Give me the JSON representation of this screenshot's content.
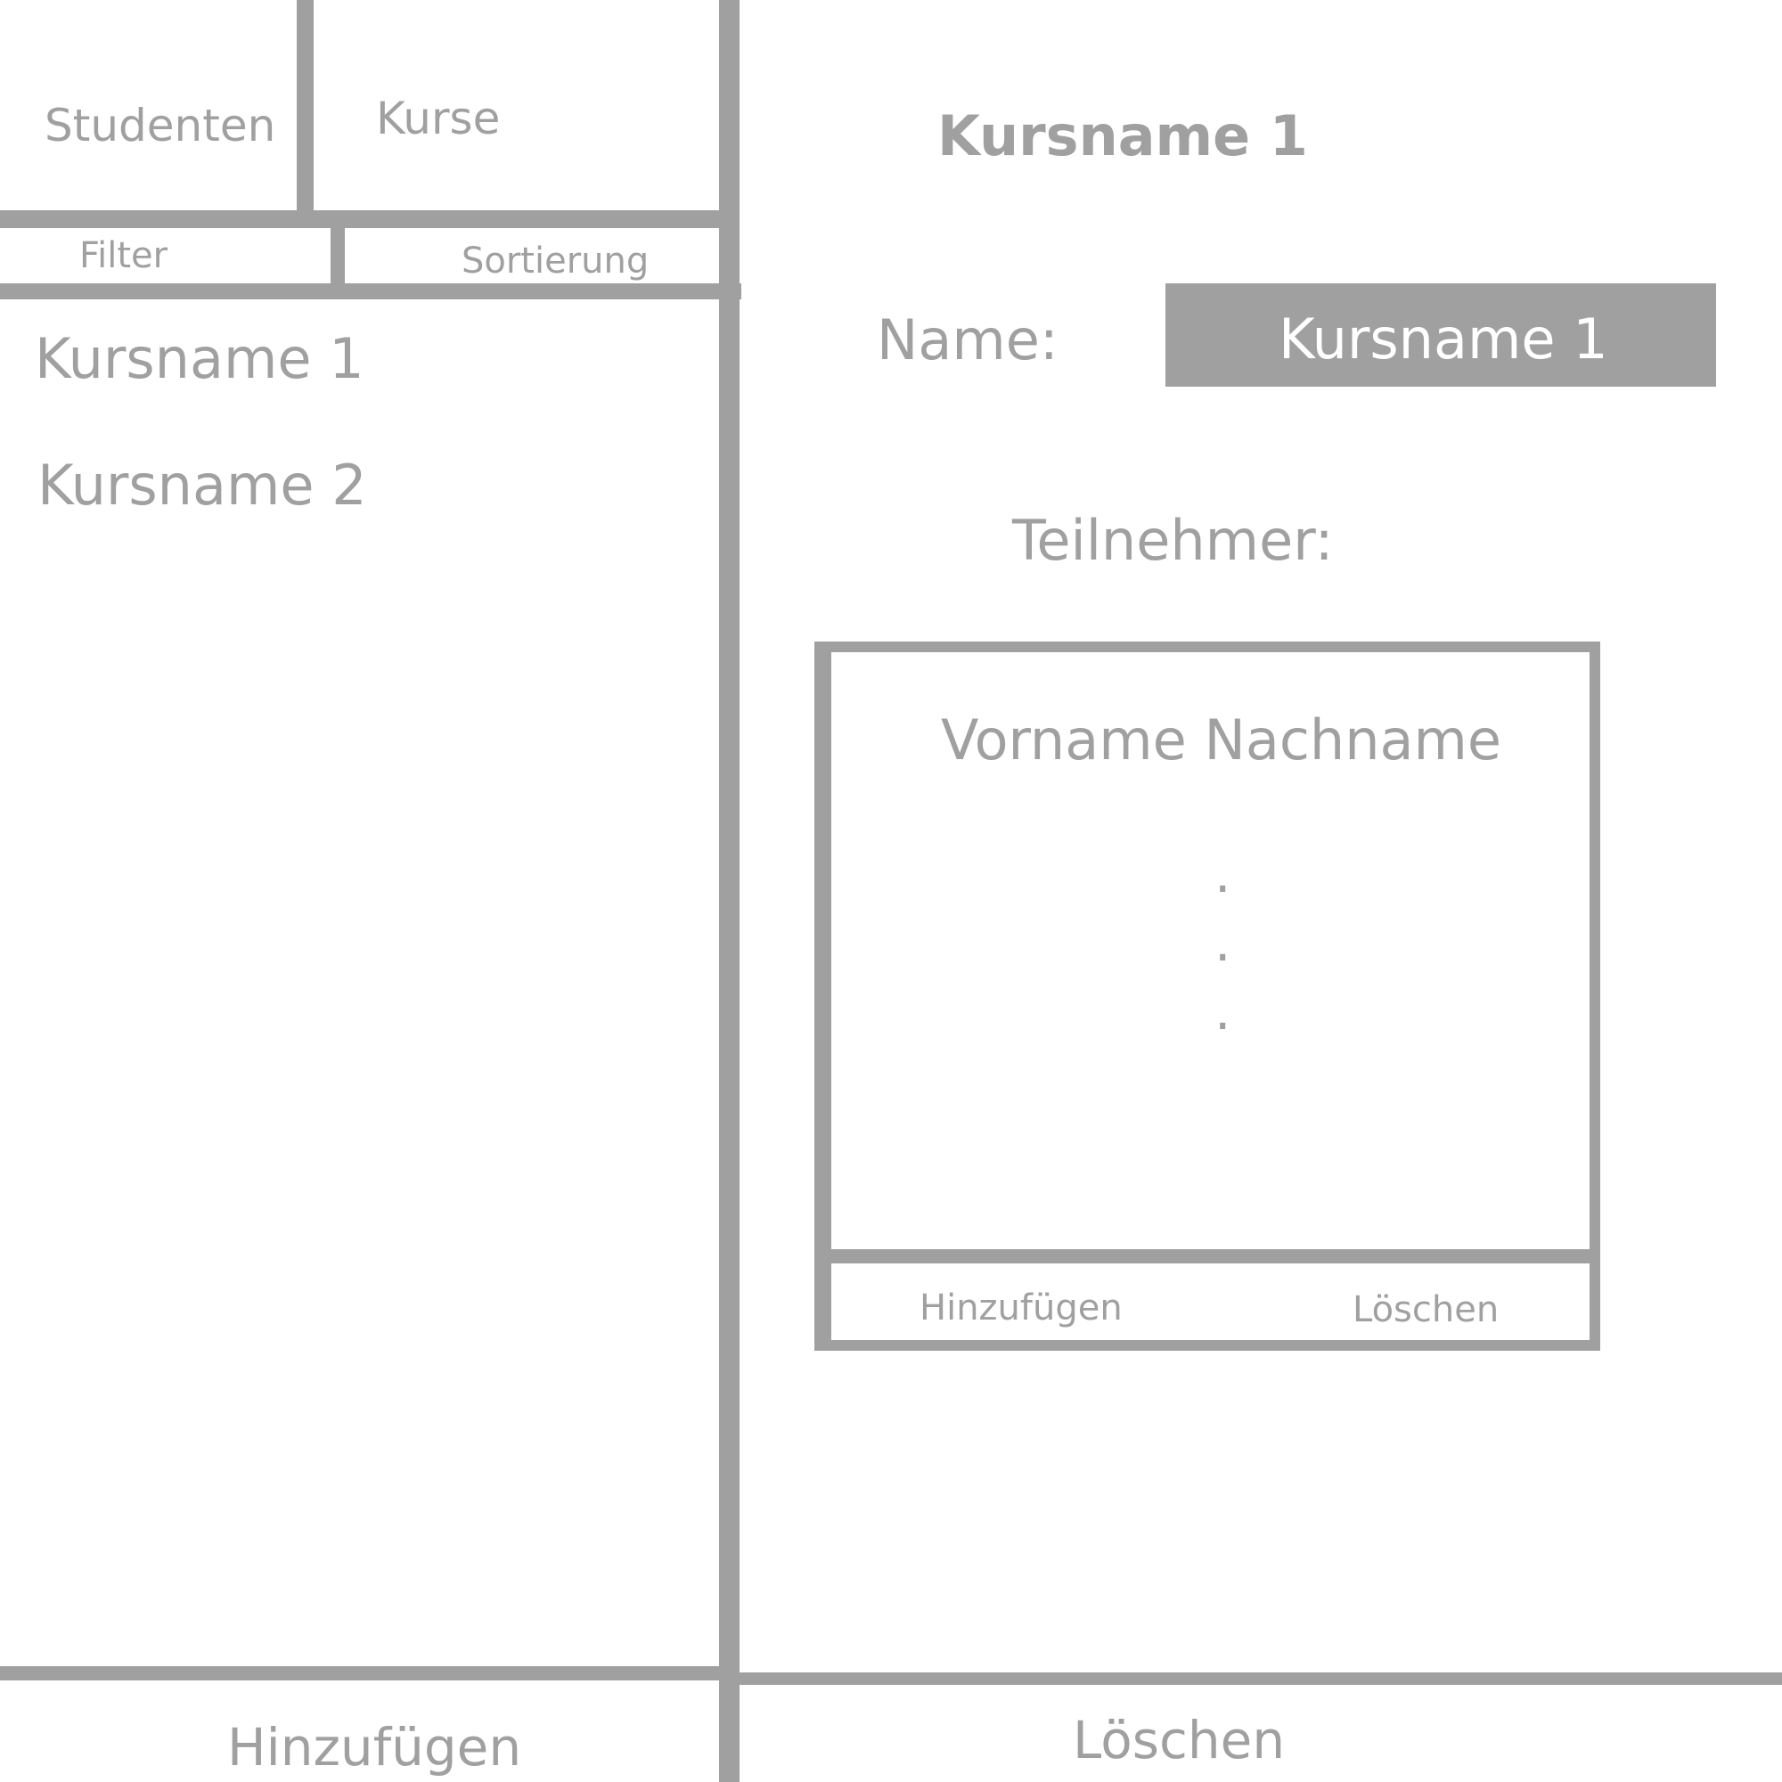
{
  "colors": {
    "line": "#a0a0a0",
    "text": "#a0a0a0",
    "field_background": "#a0a0a0",
    "field_text": "#ffffff"
  },
  "nav": {
    "tabs": [
      {
        "label": "Studenten"
      },
      {
        "label": "Kurse"
      }
    ]
  },
  "toolbar": {
    "filter_label": "Filter",
    "sort_label": "Sortierung"
  },
  "course_list": {
    "items": [
      {
        "label": "Kursname 1"
      },
      {
        "label": "Kursname 2"
      }
    ],
    "add_label": "Hinzufügen"
  },
  "detail": {
    "title": "Kursname 1",
    "name_label": "Name:",
    "name_value": "Kursname 1",
    "participants_label": "Teilnehmer:",
    "participants": {
      "items": [
        {
          "label": "Vorname Nachname"
        }
      ],
      "ellipsis": [
        ".",
        ".",
        "."
      ],
      "add_label": "Hinzufügen",
      "delete_label": "Löschen"
    },
    "delete_label": "Löschen"
  }
}
